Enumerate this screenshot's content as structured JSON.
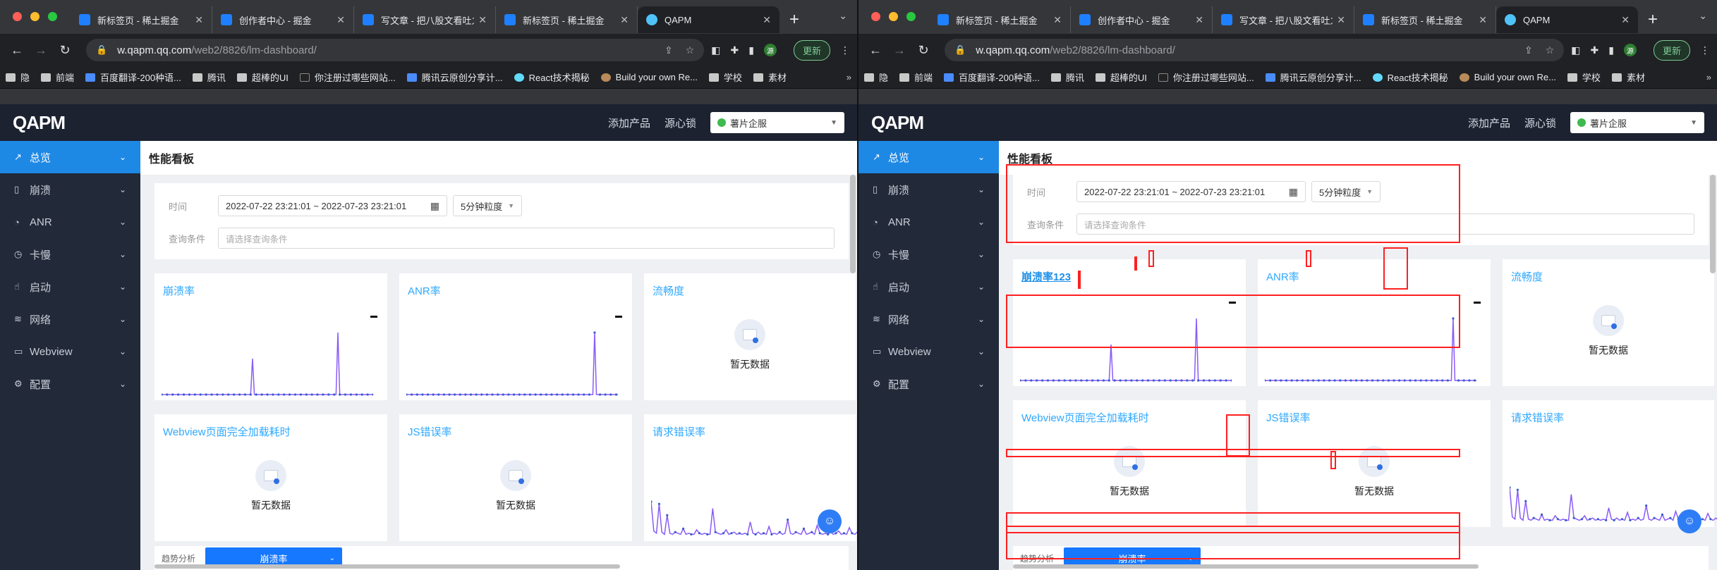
{
  "browser": {
    "tabs": [
      {
        "title": "新标签页 - 稀土掘金",
        "active": false
      },
      {
        "title": "创作者中心 - 掘金",
        "active": false
      },
      {
        "title": "写文章 - 把八股文看吐之后",
        "active": false
      },
      {
        "title": "新标签页 - 稀土掘金",
        "active": false
      },
      {
        "title": "QAPM",
        "active": true
      }
    ],
    "new_tab_symbol": "+",
    "url_host": "w.qapm.qq.com",
    "url_path": "/web2/8826/lm-dashboard/",
    "update_label": "更新",
    "profile_initial": "源",
    "bookmarks": [
      "隐",
      "前端",
      "百度翻译-200种语...",
      "腾讯",
      "超棒的UI",
      "你注册过哪些网站...",
      "腾讯云原创分享计...",
      "React技术揭秘",
      "Build your own Re...",
      "学校",
      "素材"
    ],
    "bookmarks_more": "»"
  },
  "app": {
    "logo": "QAPM",
    "add_product": "添加产品",
    "source_lock": "源心锁",
    "tenant": "薯片企服"
  },
  "sidebar": {
    "items": [
      {
        "label": "总览",
        "icon": "trend-icon",
        "active": true
      },
      {
        "label": "崩溃",
        "icon": "phone-icon",
        "active": false
      },
      {
        "label": "ANR",
        "icon": "timer-icon",
        "active": false
      },
      {
        "label": "卡慢",
        "icon": "clock-icon",
        "active": false
      },
      {
        "label": "启动",
        "icon": "launch-icon",
        "active": false
      },
      {
        "label": "网络",
        "icon": "wifi-icon",
        "active": false
      },
      {
        "label": "Webview",
        "icon": "window-icon",
        "active": false
      },
      {
        "label": "配置",
        "icon": "gear-icon",
        "active": false
      }
    ]
  },
  "page": {
    "title": "性能看板",
    "time_label": "时间",
    "time_range": "2022-07-22 23:21:01 ~ 2022-07-23 23:21:01",
    "granularity": "5分钟粒度",
    "query_label": "查询条件",
    "query_placeholder": "请选择查询条件",
    "empty_text": "暂无数据",
    "trend_label": "趋势分析",
    "trend_select": "崩溃率",
    "dash": "-"
  },
  "cards_left": [
    {
      "title": "崩溃率"
    },
    {
      "title": "ANR率"
    },
    {
      "title": "流畅度"
    },
    {
      "title": "Webview页面完全加载耗时"
    },
    {
      "title": "JS错误率"
    },
    {
      "title": "请求错误率"
    }
  ],
  "cards_right": [
    {
      "title": "崩溃率123"
    },
    {
      "title": "ANR率"
    },
    {
      "title": "流畅度"
    },
    {
      "title": "Webview页面完全加载耗时"
    },
    {
      "title": "JS错误率"
    },
    {
      "title": "请求错误率"
    }
  ],
  "colors": {
    "accent": "#1e88e5",
    "sidebar_bg": "#222939",
    "appbar_bg": "#1c2230",
    "chart_line": "#8a5cf6",
    "highlight": "#ff2020"
  },
  "chart_data": [
    {
      "type": "line",
      "series": [
        {
          "values": [
            0,
            0,
            0,
            0,
            0,
            0,
            0,
            0,
            0,
            0,
            0,
            0,
            0,
            0,
            0,
            0,
            0,
            0,
            0,
            0,
            0,
            0,
            0,
            0,
            0,
            0,
            0,
            0,
            0,
            0,
            0,
            0,
            0,
            0,
            0,
            0,
            0,
            0,
            0,
            0,
            0,
            0,
            0,
            0,
            0,
            0,
            0,
            0,
            0,
            22,
            0,
            0,
            0,
            0,
            0,
            0,
            0,
            0,
            0,
            0,
            0,
            0,
            0,
            0,
            0,
            0,
            0,
            0,
            0,
            0,
            0,
            0,
            0,
            0,
            0,
            0,
            0,
            0,
            0,
            0,
            0,
            0,
            0,
            0,
            0,
            0,
            0,
            0,
            0,
            0,
            0,
            0,
            0,
            0,
            0,
            38,
            0,
            0,
            0,
            0,
            0,
            0,
            0,
            0,
            0,
            0,
            0,
            0,
            0,
            0,
            0,
            0,
            0,
            0,
            0
          ]
        }
      ]
    },
    {
      "type": "line",
      "series": [
        {
          "values": [
            0,
            0,
            0,
            0,
            0,
            0,
            0,
            0,
            0,
            0,
            0,
            0,
            0,
            0,
            0,
            0,
            0,
            0,
            0,
            0,
            0,
            0,
            0,
            0,
            0,
            0,
            0,
            0,
            0,
            0,
            0,
            0,
            0,
            0,
            0,
            0,
            0,
            0,
            0,
            0,
            0,
            0,
            0,
            0,
            0,
            0,
            0,
            0,
            0,
            0,
            0,
            0,
            0,
            0,
            0,
            0,
            0,
            0,
            0,
            0,
            0,
            0,
            0,
            0,
            0,
            0,
            0,
            0,
            0,
            0,
            0,
            0,
            0,
            0,
            0,
            0,
            0,
            0,
            0,
            0,
            0,
            0,
            0,
            0,
            0,
            0,
            0,
            0,
            0,
            0,
            0,
            0,
            0,
            0,
            0,
            0,
            0,
            0,
            0,
            0,
            0,
            0,
            0,
            0,
            0,
            38,
            0,
            0,
            0,
            0,
            0,
            0,
            0,
            0,
            0,
            0,
            0,
            0,
            0
          ]
        }
      ]
    },
    {
      "type": "line",
      "series": [
        {
          "values": [
            30,
            4,
            2,
            28,
            3,
            1,
            18,
            2,
            1,
            3,
            2,
            1,
            6,
            1,
            2,
            1,
            1,
            5,
            2,
            1,
            2,
            1,
            1,
            24,
            3,
            2,
            1,
            2,
            5,
            1,
            2,
            3,
            1,
            2,
            1,
            2,
            1,
            12,
            2,
            1,
            3,
            1,
            2,
            1,
            8,
            1,
            2,
            1,
            3,
            1,
            2,
            14,
            2,
            1,
            3,
            2,
            1,
            6,
            1,
            2,
            3,
            1,
            9,
            2,
            1,
            2,
            1,
            3,
            1,
            2,
            4,
            1,
            2,
            1,
            7,
            2,
            1,
            3,
            1,
            2
          ]
        }
      ]
    }
  ]
}
